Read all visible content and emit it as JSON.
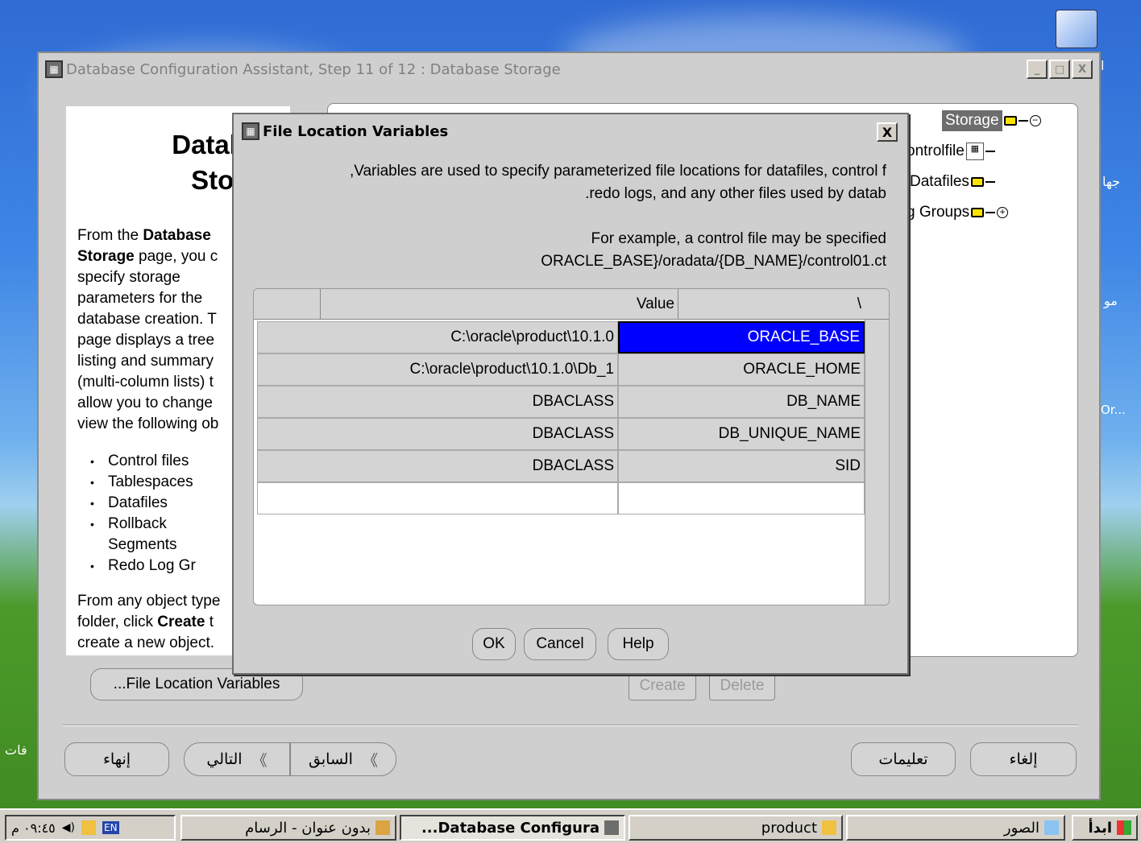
{
  "desktop": {
    "side_text_1": "ا",
    "side_text_2": "جها",
    "side_text_3": "مو",
    "side_text_4": "Or...",
    "side_text_5": "فات"
  },
  "window": {
    "title": "Database Configuration Assistant, Step 11 of 12 : Database Storage",
    "btn_min": "_",
    "btn_max": "□",
    "btn_close": "X"
  },
  "left_panel": {
    "title_line1": "Database",
    "title_line2": "Storage",
    "body": [
      {
        "b": false,
        "t": "From the "
      },
      {
        "b": true,
        "t": "Database"
      },
      {
        "b": true,
        "t": "Storage"
      },
      {
        "b": false,
        "t": " page, you c"
      }
    ],
    "lines": [
      "specify storage",
      "parameters for the",
      "database creation. T",
      "page displays a tree",
      "listing and summary",
      "(multi-column lists) t",
      "allow you to change",
      "view the following ob"
    ],
    "list": [
      "Control files",
      "Tablespaces",
      "Datafiles",
      "Rollback Segments",
      "Redo Log Gr"
    ],
    "foot_line1": "From any object type",
    "foot_line2_pre": "folder, click ",
    "foot_line2_bold": "Create",
    "foot_line2_post": " t",
    "foot_line3": "create a new object."
  },
  "tree": {
    "root": "Storage",
    "items": [
      "ontrolfile",
      "Datafiles",
      "g Groups"
    ]
  },
  "buttons": {
    "file_location": "...File Location Variables",
    "create": "Create",
    "delete": "Delete",
    "finish": "إنهاء",
    "next": "التالي",
    "back": "السابق",
    "help": "تعليمات",
    "cancel": "إلغاء",
    "next_arrow": "《",
    "back_arrow": "《"
  },
  "dialog": {
    "title": "File Location Variables",
    "close": "X",
    "text1": ",Variables are used to specify parameterized file locations for datafiles, control f",
    "text2": ".redo logs, and any other files used by datab",
    "text3": "For example, a control file may be specified",
    "text4": "ORACLE_BASE}/oradata/{DB_NAME}/control01.ct",
    "columns": [
      "Value",
      "\\"
    ],
    "rows": [
      {
        "value": "C:\\oracle\\product\\10.1.0",
        "variable": "ORACLE_BASE"
      },
      {
        "value": "C:\\oracle\\product\\10.1.0\\Db_1",
        "variable": "ORACLE_HOME"
      },
      {
        "value": "DBACLASS",
        "variable": "DB_NAME"
      },
      {
        "value": "DBACLASS",
        "variable": "DB_UNIQUE_NAME"
      },
      {
        "value": "DBACLASS",
        "variable": "SID"
      }
    ],
    "ok": "OK",
    "cancel": "Cancel",
    "help": "Help"
  },
  "taskbar": {
    "start": "ابدأ",
    "photos": "الصور",
    "product": "product",
    "dbca": "...Database Configura",
    "paint": "بدون عنوان - الرسام",
    "lang": "EN",
    "clock": "٠٩:٤٥ م"
  },
  "colors": {
    "selection": "#0000ff",
    "window_bg": "#cfcfcf",
    "folder": "#ffe400"
  }
}
